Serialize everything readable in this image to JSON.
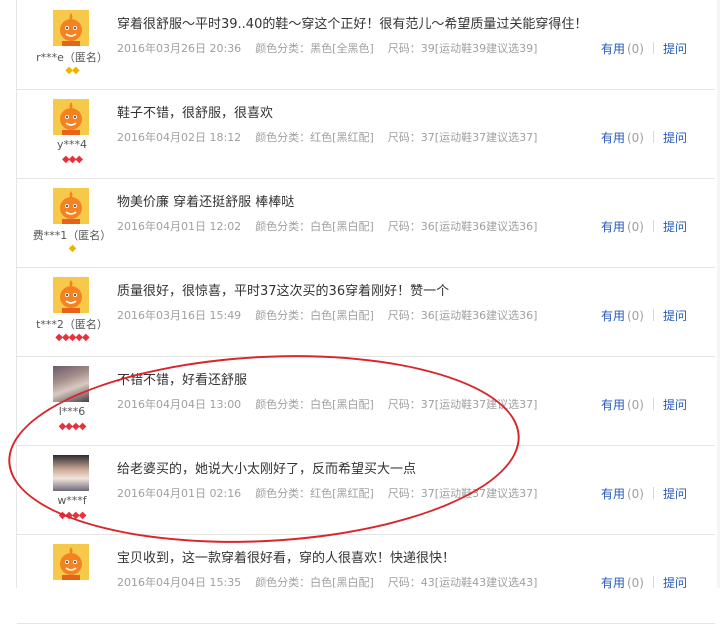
{
  "reviews": [
    {
      "user": "r***e（匿名）",
      "avatar": "mascot-avatar",
      "badge_count": 2,
      "badge_type": "gold-gem",
      "text": "穿着很舒服～平时39..40的鞋～穿这个正好！很有范儿～希望质量过关能穿得住！",
      "date": "2016年03月26日 20:36",
      "color_class": "颜色分类：黑色[全黑色]",
      "size": "尺码：39[运动鞋39建议选39]",
      "useful_label": "有用",
      "useful_count": "(0)",
      "ask_label": "提问"
    },
    {
      "user": "y***4",
      "avatar": "mascot-avatar",
      "badge_count": 3,
      "badge_type": "red-gem",
      "text": "鞋子不错，很舒服，很喜欢",
      "date": "2016年04月02日 18:12",
      "color_class": "颜色分类：红色[黑红配]",
      "size": "尺码：37[运动鞋37建议选37]",
      "useful_label": "有用",
      "useful_count": "(0)",
      "ask_label": "提问"
    },
    {
      "user": "费***1（匿名）",
      "avatar": "mascot-avatar",
      "badge_count": 1,
      "badge_type": "gold-gem",
      "text": "物美价廉 穿着还挺舒服 棒棒哒",
      "date": "2016年04月01日 12:02",
      "color_class": "颜色分类：白色[黑白配]",
      "size": "尺码：36[运动鞋36建议选36]",
      "useful_label": "有用",
      "useful_count": "(0)",
      "ask_label": "提问"
    },
    {
      "user": "t***2（匿名）",
      "avatar": "mascot-avatar",
      "badge_count": 5,
      "badge_type": "red-gem",
      "text": "质量很好，很惊喜，平时37这次买的36穿着刚好！赞一个",
      "date": "2016年03月16日 15:49",
      "color_class": "颜色分类：白色[黑白配]",
      "size": "尺码：36[运动鞋36建议选36]",
      "useful_label": "有用",
      "useful_count": "(0)",
      "ask_label": "提问"
    },
    {
      "user": "l***6",
      "avatar": "photo-avatar",
      "badge_count": 4,
      "badge_type": "red-gem",
      "text": "不错不错，好看还舒服",
      "date": "2016年04月04日 13:00",
      "color_class": "颜色分类：白色[黑白配]",
      "size": "尺码：37[运动鞋37建议选37]",
      "useful_label": "有用",
      "useful_count": "(0)",
      "ask_label": "提问"
    },
    {
      "user": "w***f",
      "avatar": "photo-avatar",
      "badge_count": 4,
      "badge_type": "red-gem",
      "text": "给老婆买的，她说大小太刚好了，反而希望买大一点",
      "date": "2016年04月01日 02:16",
      "color_class": "颜色分类：红色[黑红配]",
      "size": "尺码：37[运动鞋37建议选37]",
      "useful_label": "有用",
      "useful_count": "(0)",
      "ask_label": "提问"
    },
    {
      "user": "",
      "avatar": "mascot-avatar",
      "badge_count": 0,
      "badge_type": "red-gem",
      "text": "宝贝收到，这一款穿着很好看，穿的人很喜欢！快递很快！",
      "date": "2016年04月04日 15:35",
      "color_class": "颜色分类：白色[黑白配]",
      "size": "尺码：43[运动鞋43建议选43]",
      "useful_label": "有用",
      "useful_count": "(0)",
      "ask_label": "提问"
    }
  ],
  "colors": {
    "link": "#2458b8",
    "meta": "#a0a0a0",
    "annotation_circle": "#d9262b",
    "badge_red": "#e6323c",
    "badge_gold": "#f0b400"
  }
}
